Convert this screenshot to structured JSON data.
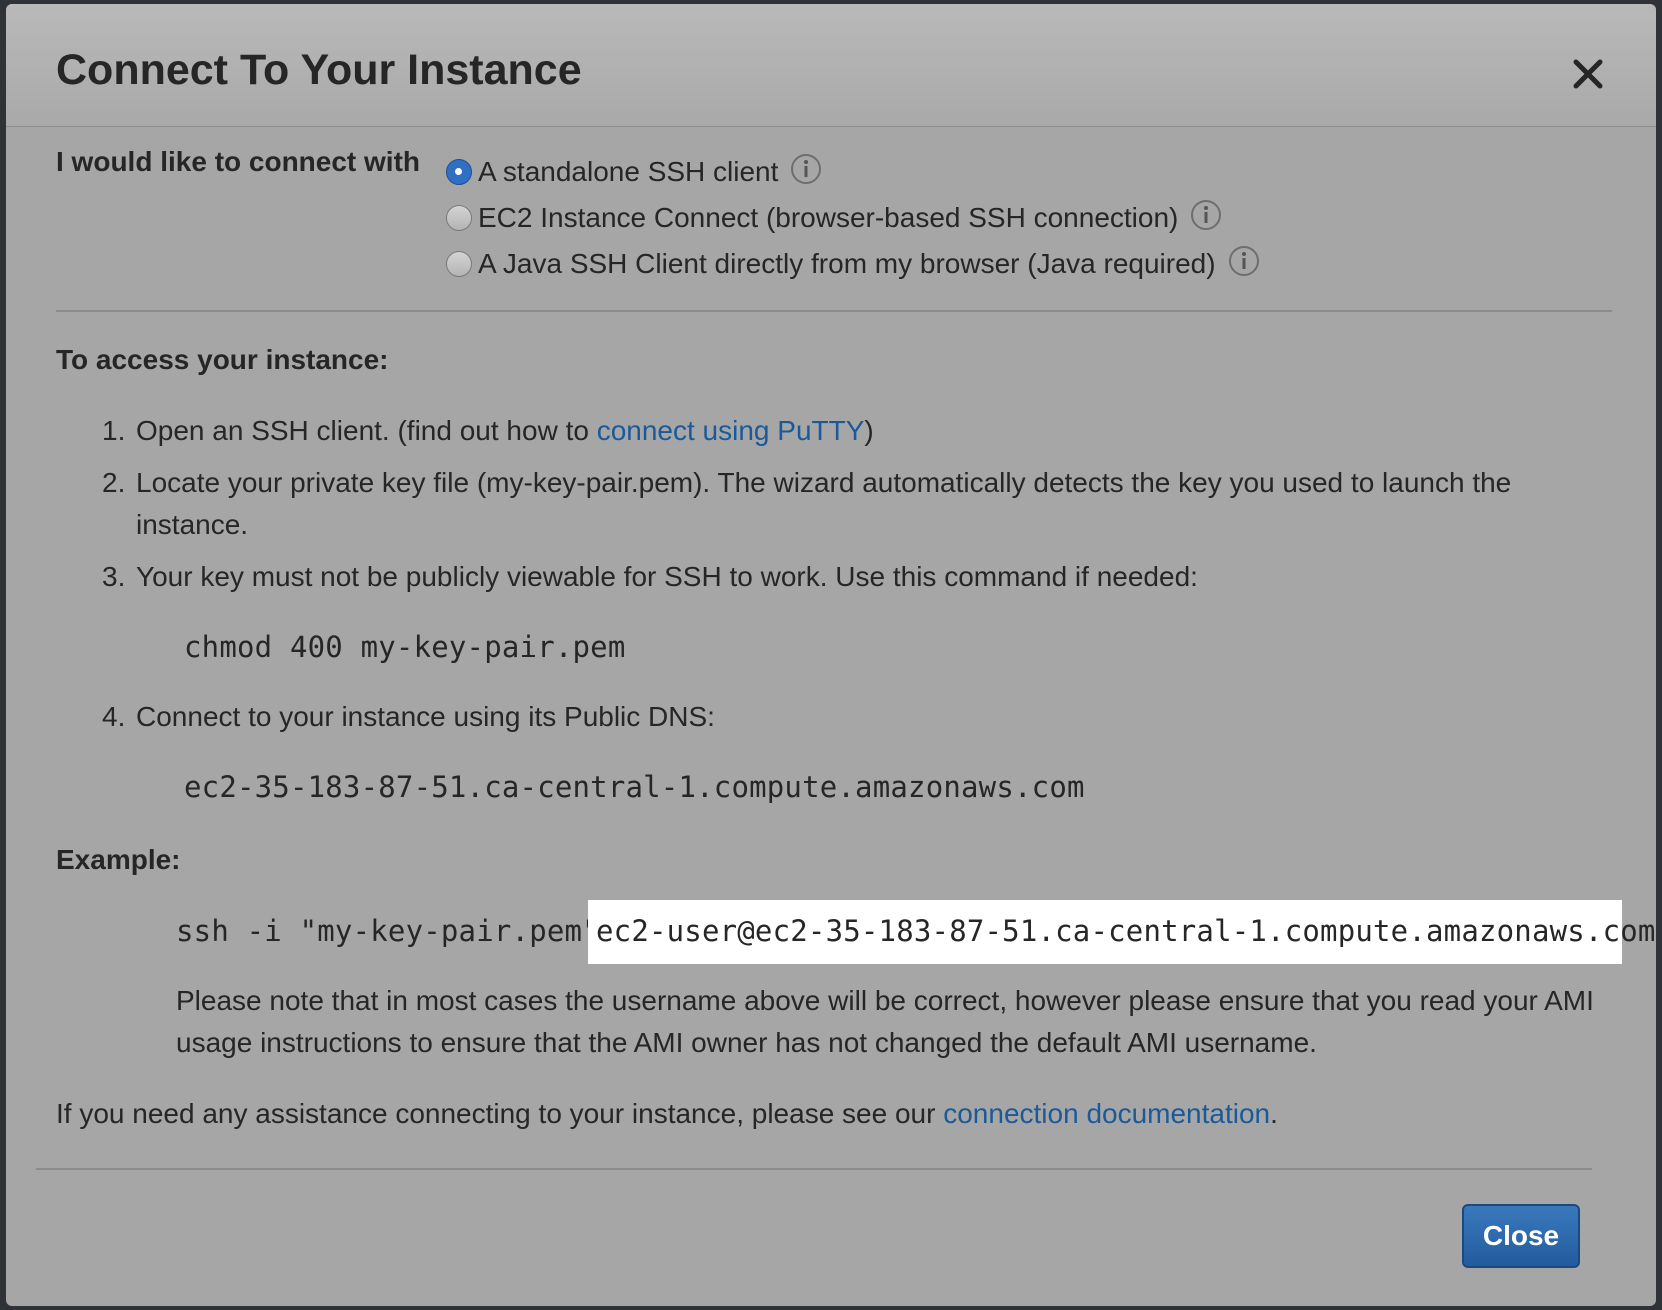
{
  "dialog": {
    "title": "Connect To Your Instance"
  },
  "connect_options": {
    "label": "I would like to connect with",
    "options": [
      {
        "label": "A standalone SSH client",
        "selected": true
      },
      {
        "label": "EC2 Instance Connect (browser-based SSH connection)",
        "selected": false
      },
      {
        "label": "A Java SSH Client directly from my browser (Java required)",
        "selected": false
      }
    ]
  },
  "access": {
    "heading": "To access your instance:",
    "steps": [
      {
        "num": "1.",
        "text": "Open an SSH client. (find out how to",
        "link": "connect using PuTTY",
        "after": ")"
      },
      {
        "num": "2.",
        "text": "Locate your private key file (my-key-pair.pem). The wizard automatically detects the key you used to launch the",
        "text2": "instance."
      },
      {
        "num": "3.",
        "text": "Your key must not be publicly viewable for SSH to work. Use this command if needed:",
        "code": "chmod 400 my-key-pair.pem"
      },
      {
        "num": "4.",
        "text": "Connect to your instance using its Public DNS:",
        "code": "ec2-35-183-87-51.ca-central-1.compute.amazonaws.com"
      }
    ]
  },
  "example": {
    "heading": "Example:",
    "command_prefix": "ssh -i \"my-key-pair.pem\"",
    "command_host": "ec2-user@ec2-35-183-87-51.ca-central-1.compute.amazonaws.com",
    "note": "Please note that in most cases the username above will be correct, however please ensure that you read your AMI usage instructions to ensure that the AMI owner has not changed the default AMI username."
  },
  "assistance": {
    "text": "If you need any assistance connecting to your instance, please see our",
    "link": "connection documentation",
    "after": "."
  },
  "footer": {
    "close_label": "Close"
  },
  "colors": {
    "dialog_bg": "#a6a6a6",
    "link": "#1a5a9a",
    "primary_button": "#2d67a8",
    "radio_selected": "#2f6fc4"
  },
  "icons": {
    "close": "close-icon",
    "info": "info-icon"
  }
}
